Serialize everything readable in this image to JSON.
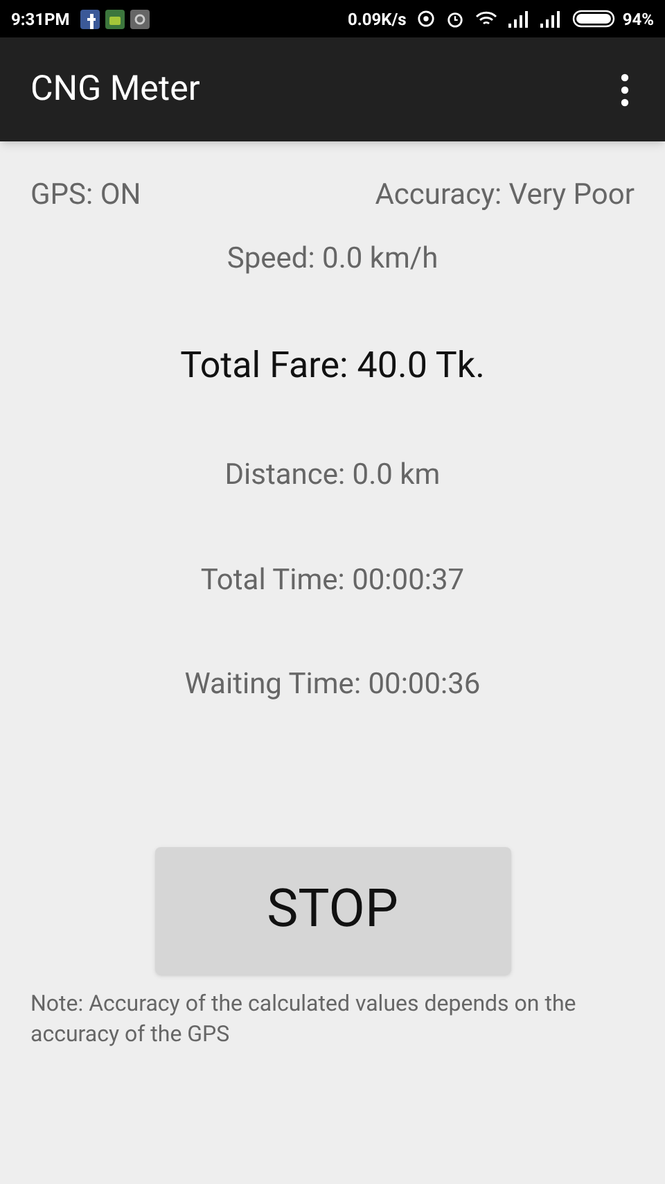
{
  "status_bar": {
    "time": "9:31PM",
    "net_speed": "0.09K/s",
    "battery": "94%"
  },
  "app_bar": {
    "title": "CNG Meter"
  },
  "gps": {
    "status": "GPS: ON",
    "accuracy": "Accuracy: Very Poor"
  },
  "speed": "Speed: 0.0 km/h",
  "total_fare": "Total Fare: 40.0 Tk.",
  "stats": [
    "Distance: 0.0 km",
    "Total Time: 00:00:37",
    "Waiting Time: 00:00:36"
  ],
  "stop_button": "STOP",
  "note": "Note: Accuracy of the calculated values depends on the accuracy of the GPS"
}
